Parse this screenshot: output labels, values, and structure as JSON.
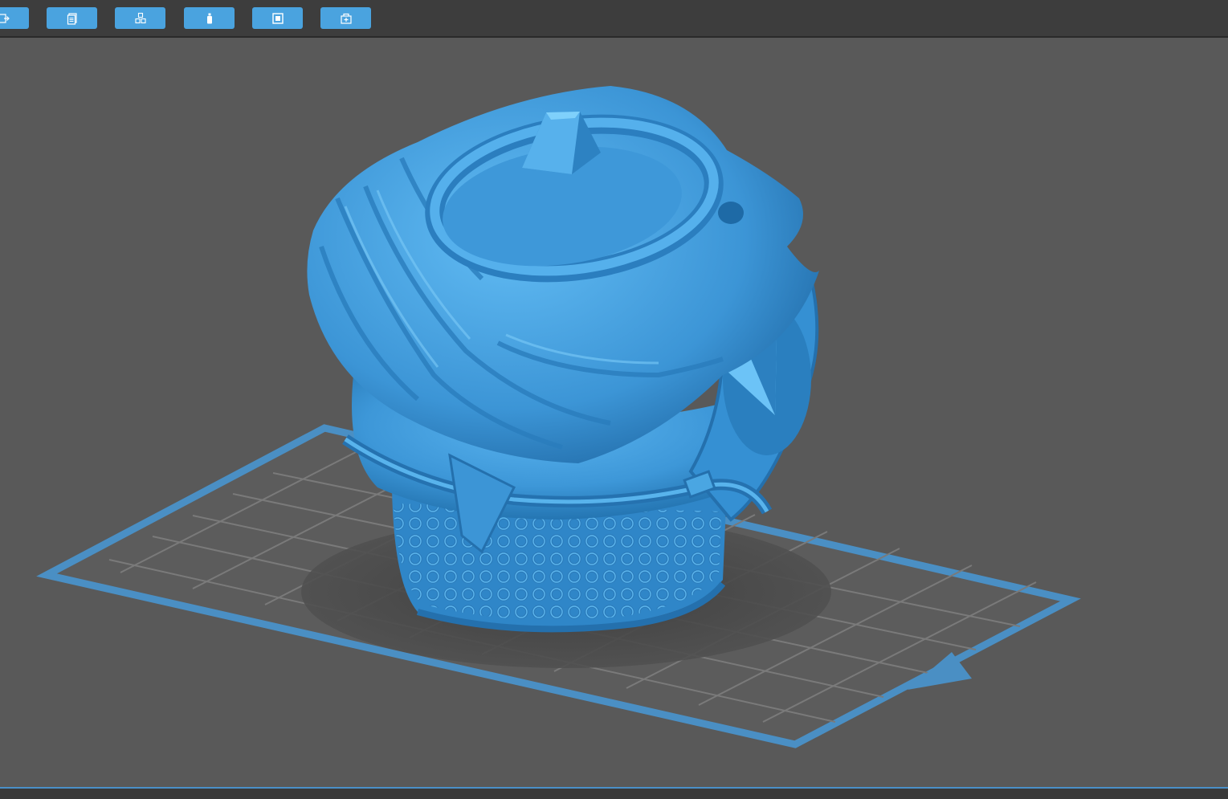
{
  "toolbar": {
    "buttons": [
      {
        "name": "export-button",
        "icon": "export-icon"
      },
      {
        "name": "layers-button",
        "icon": "pages-icon"
      },
      {
        "name": "arrange-button",
        "icon": "cubes-icon"
      },
      {
        "name": "support-button",
        "icon": "bottle-icon"
      },
      {
        "name": "hollow-button",
        "icon": "square-icon"
      },
      {
        "name": "add-model-button",
        "icon": "box-plus-icon"
      }
    ],
    "button_color": "#4aa3df"
  },
  "viewport": {
    "background_color": "#595959",
    "model_color": "#3d97d8",
    "build_plate_border_color": "#4a8fc4",
    "build_plate_grid_color": "#7a7a7a"
  }
}
